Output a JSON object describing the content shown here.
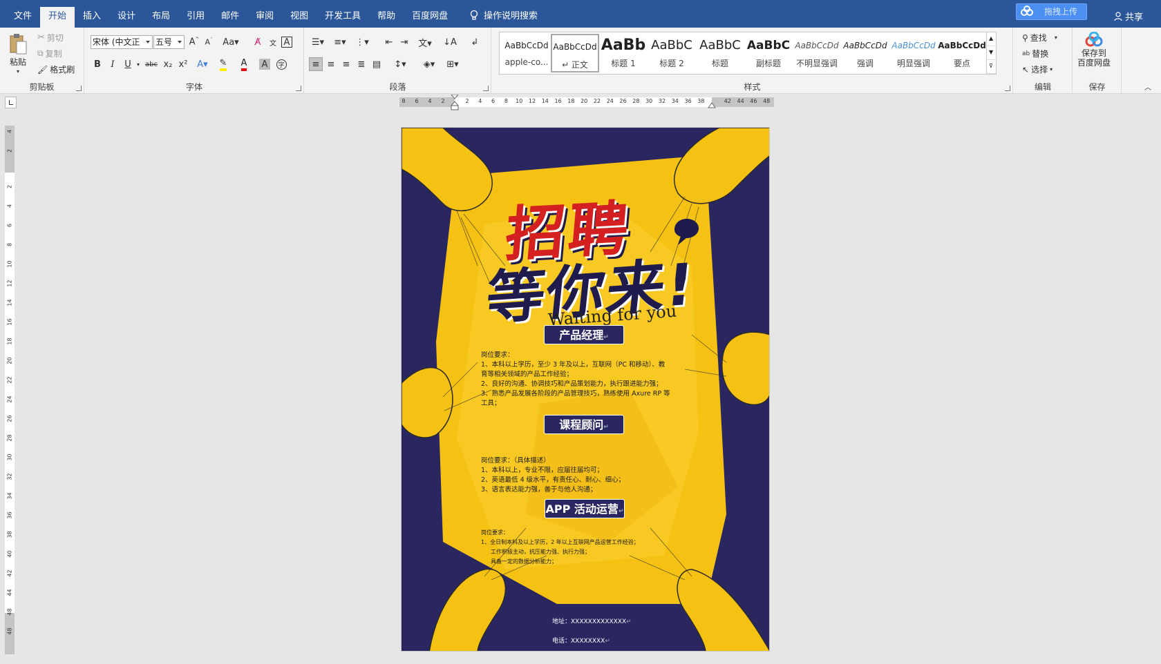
{
  "tabs": [
    "文件",
    "开始",
    "插入",
    "设计",
    "布局",
    "引用",
    "邮件",
    "审阅",
    "视图",
    "开发工具",
    "帮助",
    "百度网盘"
  ],
  "active_tab": "开始",
  "tell_me": "操作说明搜索",
  "cloud_upload_label": "拖拽上传",
  "share_label": "共享",
  "clipboard": {
    "paste": "粘贴",
    "cut": "剪切",
    "copy": "复制",
    "format_painter": "格式刷",
    "label": "剪贴板"
  },
  "font": {
    "name": "宋体 (中文正",
    "size": "五号",
    "label": "字体",
    "bold": "B",
    "italic": "I",
    "underline": "U",
    "strike": "abc",
    "sub": "x₂",
    "sup": "x²"
  },
  "paragraph": {
    "label": "段落"
  },
  "styles": {
    "label": "样式",
    "items": [
      {
        "preview": "AaBbCcDd",
        "name": "apple-co..."
      },
      {
        "preview": "AaBbCcDd",
        "name": "↵ 正文"
      },
      {
        "preview": "AaBb",
        "name": "标题 1"
      },
      {
        "preview": "AaBbC",
        "name": "标题 2"
      },
      {
        "preview": "AaBbC",
        "name": "标题"
      },
      {
        "preview": "AaBbC",
        "name": "副标题"
      },
      {
        "preview": "AaBbCcDd",
        "name": "不明显强调"
      },
      {
        "preview": "AaBbCcDd",
        "name": "强调"
      },
      {
        "preview": "AaBbCcDd",
        "name": "明显强调"
      },
      {
        "preview": "AaBbCcDd",
        "name": "要点"
      }
    ]
  },
  "editing": {
    "label": "编辑",
    "find": "查找",
    "replace": "替换",
    "select": "选择"
  },
  "save": {
    "label": "保存",
    "button_line1": "保存到",
    "button_line2": "百度网盘"
  },
  "ruler_h": [
    "8",
    "6",
    "4",
    "2",
    "2",
    "4",
    "6",
    "8",
    "10",
    "12",
    "14",
    "16",
    "18",
    "20",
    "22",
    "24",
    "26",
    "28",
    "30",
    "32",
    "34",
    "36",
    "38",
    "42",
    "44",
    "46",
    "48"
  ],
  "ruler_v": [
    "4",
    "2",
    "2",
    "4",
    "6",
    "8",
    "10",
    "12",
    "14",
    "16",
    "18",
    "20",
    "22",
    "24",
    "26",
    "28",
    "30",
    "32",
    "34",
    "36",
    "38",
    "40",
    "42",
    "44",
    "48",
    "48"
  ],
  "poster": {
    "title": "招聘",
    "subtitle": "等你来!",
    "english": "Waiting for you",
    "jobs": [
      {
        "title": "产品经理",
        "lines": [
          "岗位要求：",
          "1、本科以上学历，至少 3 年及以上，互联网（PC 和移动）、教",
          "育等相关领域的产品工作经验；",
          "2、良好的沟通、协调技巧和产品策划能力，执行跟进能力强；",
          "3、熟悉产品发展各阶段的产品管理技巧，熟练使用 Axure RP 等",
          "工具；"
        ]
      },
      {
        "title": "课程顾问",
        "lines": [
          "岗位要求：（具体描述）",
          "1、本科以上，专业不限，应届往届均可；",
          "2、英语最低 4 级水平，有责任心、耐心、细心；",
          "3、语言表达能力强，善于与他人沟通；"
        ]
      },
      {
        "title": "APP 活动运营",
        "lines": [
          "岗位要求：",
          "1、全日制本科及以上学历，2 年以上互联网产品运营工作经验；",
          "工作积极主动，抗压能力强、执行力强；",
          "具备一定的数据分析能力；"
        ]
      }
    ],
    "address": "地址：XXXXXXXXXXXXX",
    "phone": "电话：XXXXXXXX"
  },
  "colors": {
    "brand": "#2b579a",
    "poster_navy": "#2a2660",
    "poster_yellow": "#f5c214",
    "title_red": "#d42020"
  }
}
